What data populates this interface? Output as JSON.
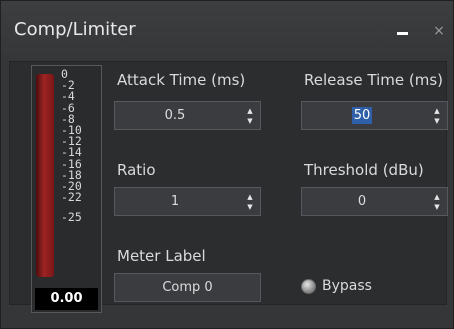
{
  "window": {
    "title": "Comp/Limiter",
    "minimize_icon": "minimize-icon",
    "close_glyph": "×",
    "close_icon": "close-icon"
  },
  "meter": {
    "scale": [
      "0",
      "-2",
      "-4",
      "-6",
      "-8",
      "-10",
      "-12",
      "-14",
      "-16",
      "-18",
      "-20",
      "-22",
      "-25"
    ],
    "value": "0.00",
    "fill_fraction": 0.95,
    "color": "#9f2424"
  },
  "controls": {
    "attack": {
      "label": "Attack Time (ms)",
      "value": "0.5"
    },
    "release": {
      "label": "Release Time (ms)",
      "value": "50",
      "selected": true
    },
    "ratio": {
      "label": "Ratio",
      "value": "1"
    },
    "threshold": {
      "label": "Threshold (dBu)",
      "value": "0"
    },
    "meter_label": {
      "label": "Meter Label",
      "value": "Comp 0"
    },
    "bypass": {
      "label": "Bypass"
    }
  },
  "spin_glyphs": {
    "up": "▲",
    "down": "▼"
  },
  "colors": {
    "background": "#353638",
    "field": "#3b3c3f",
    "selection": "#2f5fa8",
    "text": "#dadada"
  }
}
